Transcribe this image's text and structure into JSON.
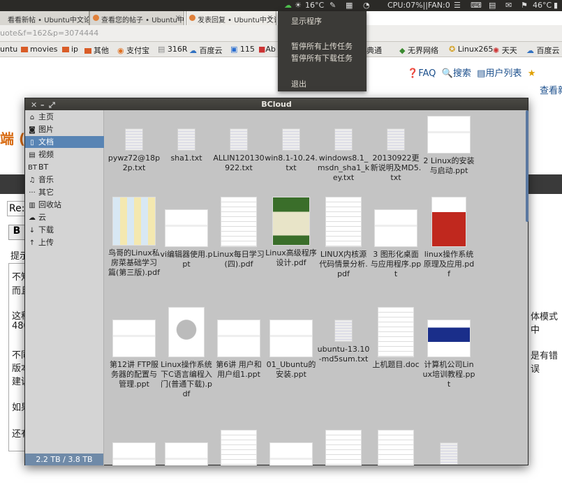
{
  "browser": {
    "tabs": [
      {
        "label": "看看新帖 • Ubuntu中文论坛"
      },
      {
        "label": "查看您的帖子 • Ubuntu中文"
      },
      {
        "label": "发表回复 • Ubuntu中文论坛"
      }
    ],
    "url": "uote&f=162&p=3074444",
    "bookmarks": [
      "untu",
      "movies",
      "ip",
      "其他",
      "支付宝",
      "316R",
      "百度云",
      "115",
      "Ab",
      "详典通",
      "无界网络",
      "Linux265",
      "天天",
      "百度云"
    ]
  },
  "tray": {
    "temp": "16°C",
    "cpu": "CPU:07%||FAN:0",
    "cpu_temp": "46°C"
  },
  "tray_menu": {
    "items": [
      "显示程序",
      "暂停所有上传任务",
      "暂停所有下载任务",
      "退出"
    ]
  },
  "site": {
    "nav": {
      "faq": "FAQ",
      "search": "搜索",
      "members": "用户列表"
    },
    "view_new": "查看新",
    "brand_char": "端 (",
    "reply_prefix": "Re:",
    "bold_btn": "B",
    "hint": "提示",
    "body_lines": [
      "不知",
      "而且",
      "这种",
      "480",
      "不同",
      "版本",
      "建议",
      "如果",
      "还有",
      "体模式中",
      "是有错误"
    ]
  },
  "window": {
    "title": "BCloud",
    "sidebar": [
      {
        "label": "主页",
        "icon": "home-icon"
      },
      {
        "label": "图片",
        "icon": "camera-icon"
      },
      {
        "label": "文档",
        "icon": "document-icon"
      },
      {
        "label": "视频",
        "icon": "film-icon"
      },
      {
        "label": "BT",
        "icon": "bt-icon"
      },
      {
        "label": "音乐",
        "icon": "music-icon"
      },
      {
        "label": "其它",
        "icon": "more-icon"
      },
      {
        "label": "回收站",
        "icon": "trash-icon"
      },
      {
        "label": "云",
        "icon": "cloud-icon"
      },
      {
        "label": "下载",
        "icon": "download-icon"
      },
      {
        "label": "上传",
        "icon": "upload-icon"
      }
    ],
    "selected": "文档",
    "quota": "2.2 TB / 3.8 TB",
    "files": [
      {
        "name": "pywz72@18p2p.txt",
        "kind": "text"
      },
      {
        "name": "sha1.txt",
        "kind": "text"
      },
      {
        "name": "ALLIN120130922.txt",
        "kind": "text"
      },
      {
        "name": "win8.1-10.24.txt",
        "kind": "text"
      },
      {
        "name": "windows8.1_msdn_sha1_key.txt",
        "kind": "text"
      },
      {
        "name": "20130922更新说明及MD5.txt",
        "kind": "text"
      },
      {
        "name": "2 Linux的安装与启动.ppt",
        "kind": "slide"
      },
      {
        "name": "鸟哥的Linux私房菜基础学习篇(第三版).pdf",
        "kind": "table"
      },
      {
        "name": "vi编辑器使用.ppt",
        "kind": "slide"
      },
      {
        "name": "Linux每日学习(四).pdf",
        "kind": "page"
      },
      {
        "name": "Linux高级程序设计.pdf",
        "kind": "book"
      },
      {
        "name": "LINUX内核源代码情景分析.pdf",
        "kind": "page"
      },
      {
        "name": "3 图形化桌面与应用程序.ppt",
        "kind": "slide"
      },
      {
        "name": "linux操作系统原理及应用.pdf",
        "kind": "book2"
      },
      {
        "name": "第12讲 FTP服务器的配置与管理.ppt",
        "kind": "slide"
      },
      {
        "name": "Linux操作系统下C语言编程入门(普通下载).pdf",
        "kind": "cover"
      },
      {
        "name": "第6讲 用户和用户组1.ppt",
        "kind": "slide"
      },
      {
        "name": "01_Ubuntu的安装.ppt",
        "kind": "slide"
      },
      {
        "name": "ubuntu-13.10-md5sum.txt",
        "kind": "text"
      },
      {
        "name": "上机题目.doc",
        "kind": "page"
      },
      {
        "name": "计算机公司Linux培训教程.ppt",
        "kind": "blue"
      },
      {
        "name": "",
        "kind": "slide"
      },
      {
        "name": "",
        "kind": "slide"
      },
      {
        "name": "",
        "kind": "page"
      },
      {
        "name": "",
        "kind": "slide"
      },
      {
        "name": "",
        "kind": "page"
      },
      {
        "name": "",
        "kind": "page"
      },
      {
        "name": "",
        "kind": "text"
      }
    ]
  }
}
